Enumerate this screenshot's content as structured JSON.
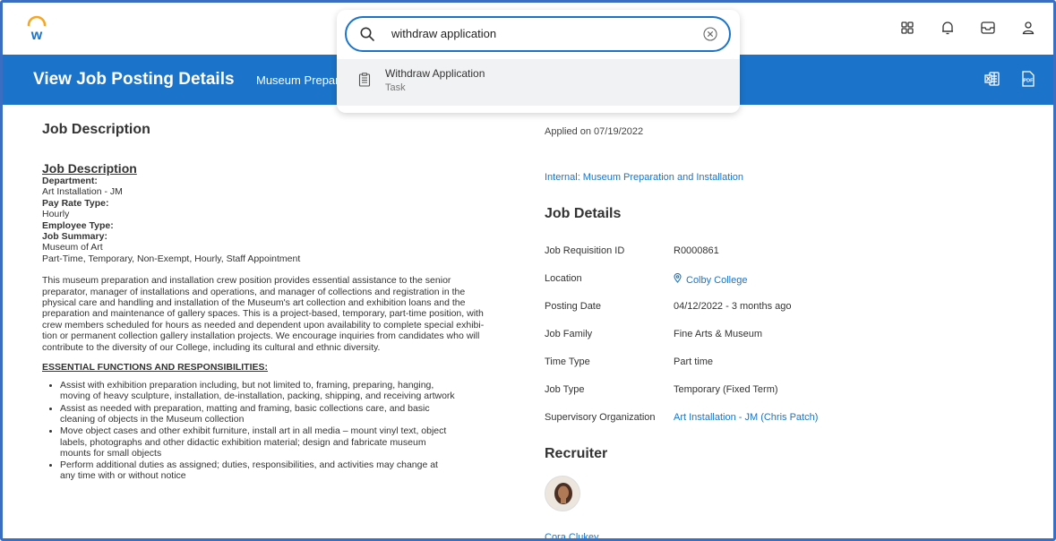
{
  "app": {
    "logo": "workday-logo",
    "top_icons": [
      "apps-grid-icon",
      "bell-icon",
      "inbox-icon",
      "profile-icon"
    ]
  },
  "header": {
    "title": "View Job Posting Details",
    "subtitle": "Museum Prepar",
    "icons": [
      "excel-export-icon",
      "pdf-export-icon"
    ]
  },
  "search": {
    "query": "withdraw application",
    "results": [
      {
        "title": "Withdraw Application",
        "type": "Task"
      }
    ]
  },
  "job_description": {
    "heading": "Job Description",
    "subheading": "Job Description",
    "fields": [
      {
        "label": "Department:",
        "value": "Art Installation - JM"
      },
      {
        "label": "Pay Rate Type:",
        "value": "Hourly"
      },
      {
        "label": "Employee Type:",
        "value": ""
      },
      {
        "label": "Job Summary:",
        "value": "Museum of Art"
      }
    ],
    "summary_line": "Part-Time, Temporary, Non-Exempt, Hourly, Staff Appointment",
    "paragraph_lines": [
      "This museum preparation and installation crew position provides essential assistance to the senior",
      "preparator, manager of installations and operations, and manager of collections and registration in the",
      "physical care and handling and installation of the Museum's art collection and exhibition loans and the",
      "preparation and maintenance of gallery spaces. This is a project-based, temporary, part-time position, with",
      "crew members scheduled for hours as needed and dependent upon availability to complete special exhibi-",
      "tion or permanent collection gallery installation projects. We encourage inquiries from candidates who will",
      "contribute to the diversity of our College, including its cultural and ethnic diversity."
    ],
    "essential_title": "ESSENTIAL FUNCTIONS AND RESPONSIBILITIES:",
    "bullets": [
      [
        "Assist with exhibition preparation including, but not limited to, framing, preparing, hanging,",
        "moving of heavy sculpture, installation, de-installation, packing, shipping, and receiving artwork"
      ],
      [
        "Assist as needed with preparation, matting and framing, basic collections care, and basic",
        "cleaning of objects in the Museum collection"
      ],
      [
        "Move object cases and other exhibit furniture, install art in all media – mount vinyl text, object",
        "labels, photographs and other didactic exhibition material; design and fabricate museum",
        "mounts for small objects"
      ],
      [
        "Perform additional duties as assigned; duties, responsibilities, and activities may change at",
        "any time with or without notice"
      ]
    ]
  },
  "application": {
    "applied_on": "Applied on 07/19/2022",
    "internal_link": "Internal: Museum Preparation and Installation"
  },
  "job_details": {
    "heading": "Job Details",
    "rows": [
      {
        "label": "Job Requisition ID",
        "value": "R0000861"
      },
      {
        "label": "Location",
        "value": "Colby College"
      },
      {
        "label": "Posting Date",
        "value": "04/12/2022 - 3 months ago"
      },
      {
        "label": "Job Family",
        "value": "Fine Arts & Museum"
      },
      {
        "label": "Time Type",
        "value": "Part time"
      },
      {
        "label": "Job Type",
        "value": "Temporary (Fixed Term)"
      },
      {
        "label": "Supervisory Organization",
        "value": "Art Installation - JM (Chris Patch)"
      }
    ]
  },
  "recruiter": {
    "heading": "Recruiter",
    "name": "Cora Clukey"
  },
  "colors": {
    "brand_blue": "#1b74c9",
    "link_blue": "#1b74c9",
    "logo_orange": "#f5a623"
  }
}
